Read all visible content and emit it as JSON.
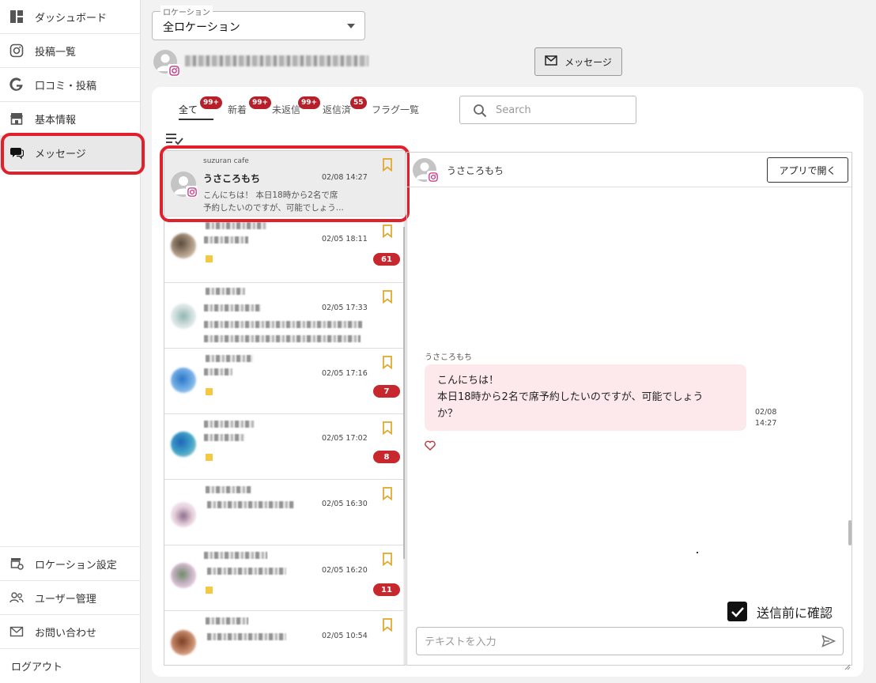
{
  "sidebar": {
    "items": [
      {
        "label": "ダッシュボード",
        "icon": "dashboard-icon"
      },
      {
        "label": "投稿一覧",
        "icon": "instagram-icon"
      },
      {
        "label": "口コミ・投稿",
        "icon": "google-icon"
      },
      {
        "label": "基本情報",
        "icon": "store-icon"
      },
      {
        "label": "メッセージ",
        "icon": "chat-icon",
        "active": true
      }
    ],
    "bottom_items": [
      {
        "label": "ロケーション設定",
        "icon": "location-settings-icon"
      },
      {
        "label": "ユーザー管理",
        "icon": "users-icon"
      },
      {
        "label": "お問い合わせ",
        "icon": "mail-icon"
      },
      {
        "label": "ログアウト"
      }
    ]
  },
  "location": {
    "legend": "ロケーション",
    "value": "全ロケーション"
  },
  "header": {
    "message_button_label": "メッセージ"
  },
  "tabs": [
    {
      "label": "全て",
      "badge": "99+",
      "active": true
    },
    {
      "label": "新着",
      "badge": "99+"
    },
    {
      "label": "未返信",
      "badge": "99+"
    },
    {
      "label": "返信済",
      "badge": "55"
    },
    {
      "label": "フラグ一覧"
    }
  ],
  "search": {
    "placeholder": "Search"
  },
  "conversations": [
    {
      "account": "suzuran cafe",
      "name": "うさころもち",
      "time": "02/08 14:27",
      "preview_line1": "こんにちは！ 本日18時から2名で席",
      "preview_line2": "予約したいのですが、可能でしょう...",
      "selected": true
    },
    {
      "time": "02/05 18:11",
      "count": "61"
    },
    {
      "time": "02/05 17:33"
    },
    {
      "time": "02/05 17:16",
      "count": "7"
    },
    {
      "time": "02/05 17:02",
      "count": "8"
    },
    {
      "time": "02/05 16:30"
    },
    {
      "time": "02/05 16:20",
      "count": "11"
    },
    {
      "time": "02/05 10:54"
    }
  ],
  "chat": {
    "contact_name": "うさころもち",
    "open_app_label": "アプリで開く",
    "message": {
      "sender": "うさころもち",
      "line1": "こんにちは！",
      "line2": "本日18時から2名で席予約したいのですが、可能でしょう",
      "line3": "か？",
      "date": "02/08",
      "time": "14:27"
    },
    "confirm_label": "送信前に確認",
    "confirm_checked": true,
    "input_placeholder": "テキストを入力"
  },
  "colors": {
    "badge": "#b5202a",
    "count_badge": "#c6282e",
    "bookmark": "#e0a526",
    "highlight": "#e0202a",
    "bubble": "#fde9ec"
  }
}
